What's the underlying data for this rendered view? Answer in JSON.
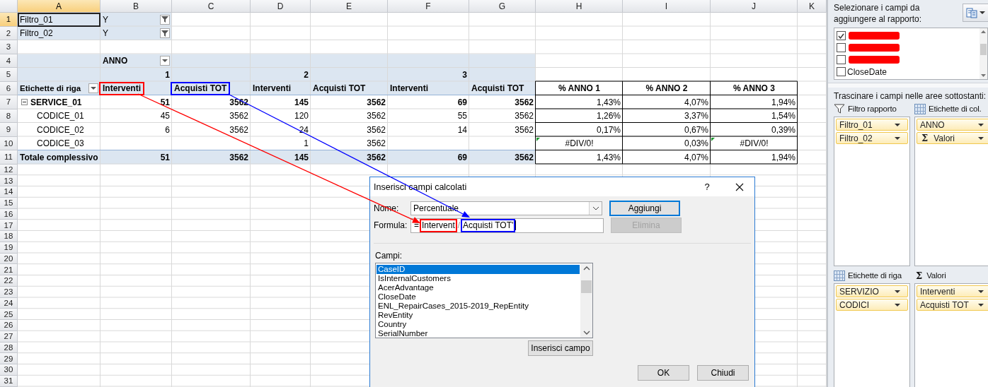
{
  "sheet": {
    "columns": [
      {
        "label": "A",
        "selected": true
      },
      {
        "label": "B",
        "selected": false
      },
      {
        "label": "C",
        "selected": false
      },
      {
        "label": "D",
        "selected": false
      },
      {
        "label": "E",
        "selected": false
      },
      {
        "label": "F",
        "selected": false
      },
      {
        "label": "G",
        "selected": false
      },
      {
        "label": "H",
        "selected": false
      },
      {
        "label": "I",
        "selected": false
      },
      {
        "label": "J",
        "selected": false
      },
      {
        "label": "K",
        "selected": false
      }
    ],
    "row_numbers": [
      {
        "label": "1",
        "selected": true
      },
      {
        "label": "2",
        "selected": false
      },
      {
        "label": "3",
        "selected": false
      },
      {
        "label": "4",
        "selected": false
      },
      {
        "label": "5",
        "selected": false
      },
      {
        "label": "6",
        "selected": false
      },
      {
        "label": "7",
        "selected": false
      },
      {
        "label": "8",
        "selected": false
      },
      {
        "label": "9",
        "selected": false
      },
      {
        "label": "10",
        "selected": false
      },
      {
        "label": "11",
        "selected": false
      },
      {
        "label": "12",
        "selected": false
      },
      {
        "label": "13",
        "selected": false
      },
      {
        "label": "14",
        "selected": false
      },
      {
        "label": "15",
        "selected": false
      },
      {
        "label": "16",
        "selected": false
      },
      {
        "label": "17",
        "selected": false
      },
      {
        "label": "18",
        "selected": false
      },
      {
        "label": "19",
        "selected": false
      },
      {
        "label": "20",
        "selected": false
      },
      {
        "label": "21",
        "selected": false
      },
      {
        "label": "22",
        "selected": false
      },
      {
        "label": "23",
        "selected": false
      },
      {
        "label": "24",
        "selected": false
      },
      {
        "label": "25",
        "selected": false
      },
      {
        "label": "26",
        "selected": false
      },
      {
        "label": "27",
        "selected": false
      },
      {
        "label": "28",
        "selected": false
      },
      {
        "label": "29",
        "selected": false
      },
      {
        "label": "30",
        "selected": false
      },
      {
        "label": "31",
        "selected": false
      }
    ],
    "filters": [
      {
        "label": "Filtro_01",
        "value": "Y",
        "selected": true
      },
      {
        "label": "Filtro_02",
        "value": "Y",
        "selected": false
      }
    ],
    "pivot": {
      "column_field": "ANNO",
      "years": [
        "1",
        "2",
        "3"
      ],
      "row_header": "Etichette di riga",
      "value_headers": [
        {
          "label": "Interventi",
          "color": "#ff0000"
        },
        {
          "label": "Acquisti TOT",
          "color": "#0000ff"
        },
        {
          "label": "Interventi"
        },
        {
          "label": "Acquisti TOT"
        },
        {
          "label": "Interventi"
        },
        {
          "label": "Acquisti TOT"
        }
      ],
      "rows": [
        {
          "label": "SERVICE_01",
          "kind": "group",
          "expanded": true,
          "by_year": [
            {
              "kind": "value",
              "interventi": "51",
              "acquisti_tot": "3562"
            },
            {
              "kind": "value",
              "interventi": "145",
              "acquisti_tot": "3562"
            },
            {
              "kind": "value",
              "interventi": "69",
              "acquisti_tot": "3562"
            }
          ]
        },
        {
          "label": "CODICE_01",
          "kind": "item",
          "by_year": [
            {
              "kind": "value",
              "interventi": "45",
              "acquisti_tot": "3562"
            },
            {
              "kind": "value",
              "interventi": "120",
              "acquisti_tot": "3562"
            },
            {
              "kind": "value",
              "interventi": "55",
              "acquisti_tot": "3562"
            }
          ]
        },
        {
          "label": "CODICE_02",
          "kind": "item",
          "by_year": [
            {
              "kind": "value",
              "interventi": "6",
              "acquisti_tot": "3562"
            },
            {
              "kind": "value",
              "interventi": "24",
              "acquisti_tot": "3562"
            },
            {
              "kind": "value",
              "interventi": "14",
              "acquisti_tot": "3562"
            }
          ]
        },
        {
          "label": "CODICE_03",
          "kind": "item",
          "by_year": [
            {
              "kind": "empty"
            },
            {
              "kind": "value",
              "interventi": "1",
              "acquisti_tot": "3562"
            },
            {
              "kind": "empty"
            }
          ]
        },
        {
          "label": "Totale complessivo",
          "kind": "total",
          "by_year": [
            {
              "kind": "value",
              "interventi": "51",
              "acquisti_tot": "3562"
            },
            {
              "kind": "value",
              "interventi": "145",
              "acquisti_tot": "3562"
            },
            {
              "kind": "value",
              "interventi": "69",
              "acquisti_tot": "3562"
            }
          ]
        }
      ]
    },
    "percent_table": {
      "headers": [
        "% ANNO 1",
        "% ANNO 2",
        "% ANNO 3"
      ],
      "rows": [
        [
          {
            "text": "1,43%",
            "error": false
          },
          {
            "text": "4,07%",
            "error": false
          },
          {
            "text": "1,94%",
            "error": false
          }
        ],
        [
          {
            "text": "1,26%",
            "error": false
          },
          {
            "text": "3,37%",
            "error": false
          },
          {
            "text": "1,54%",
            "error": false
          }
        ],
        [
          {
            "text": "0,17%",
            "error": false
          },
          {
            "text": "0,67%",
            "error": false
          },
          {
            "text": "0,39%",
            "error": false
          }
        ],
        [
          {
            "text": "#DIV/0!",
            "error": true
          },
          {
            "text": "0,03%",
            "error": false
          },
          {
            "text": "#DIV/0!",
            "error": true
          }
        ],
        [
          {
            "text": "1,43%",
            "error": false
          },
          {
            "text": "4,07%",
            "error": false
          },
          {
            "text": "1,94%",
            "error": false
          }
        ]
      ]
    }
  },
  "pivot_panel": {
    "prompt": "Selezionare i campi da aggiungere al rapporto:",
    "fields": [
      {
        "kind": "redacted",
        "checked": true
      },
      {
        "kind": "redacted",
        "checked": false
      },
      {
        "kind": "redacted",
        "checked": false
      },
      {
        "kind": "named",
        "checked": false,
        "label": "CloseDate"
      }
    ],
    "drag_hint": "Trascinare i campi nelle aree sottostanti:",
    "areas": [
      {
        "kind": "filter",
        "title": "Filtro rapporto",
        "items": [
          {
            "label": "Filtro_01"
          },
          {
            "label": "Filtro_02"
          }
        ]
      },
      {
        "kind": "columns",
        "title": "Etichette di col.",
        "items": [
          {
            "label": "ANNO"
          },
          {
            "label": "Valori",
            "symbol": "Σ"
          }
        ]
      },
      {
        "kind": "rows",
        "title": "Etichette di riga",
        "items": [
          {
            "label": "SERVIZIO"
          },
          {
            "label": "CODICI"
          }
        ]
      },
      {
        "kind": "values",
        "title": "Valori",
        "symbol": "Σ",
        "items": [
          {
            "label": "Interventi"
          },
          {
            "label": "Acquisti TOT"
          }
        ]
      }
    ]
  },
  "dialog": {
    "title": "Inserisci campi calcolati",
    "help": "?",
    "name_label": "Nome:",
    "name_value": "Percentuale",
    "formula_label": "Formula:",
    "formula": [
      {
        "text": "="
      },
      {
        "text": "Intervent",
        "color": "#ff0000"
      },
      {
        "text": "/"
      },
      {
        "text": "Acquisti TOT'",
        "color": "#0000ff"
      }
    ],
    "buttons": [
      {
        "label": "Aggiungi",
        "default": true,
        "disabled": false
      },
      {
        "label": "Elimina",
        "default": false,
        "disabled": true
      }
    ],
    "fields_label": "Campi:",
    "fields": [
      {
        "label": "CaseID",
        "selected": true
      },
      {
        "label": "IsInternalCustomers",
        "selected": false
      },
      {
        "label": "AcerAdvantage",
        "selected": false
      },
      {
        "label": "CloseDate",
        "selected": false
      },
      {
        "label": "ENL_RepairCases_2015-2019_RepEntity",
        "selected": false
      },
      {
        "label": "RevEntity",
        "selected": false
      },
      {
        "label": "Country",
        "selected": false
      },
      {
        "label": "SerialNumber",
        "selected": false
      }
    ],
    "insert_button": "Inserisci campo",
    "footer_buttons": [
      "OK",
      "Chiudi"
    ]
  }
}
